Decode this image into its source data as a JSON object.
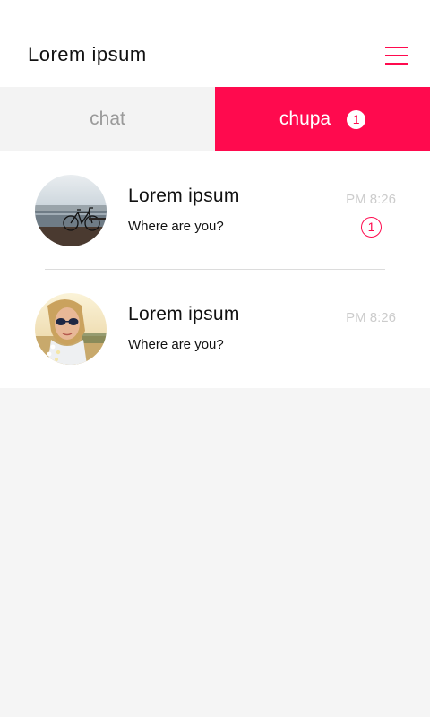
{
  "header": {
    "title": "Lorem ipsum",
    "menu_icon": "hamburger-menu-icon"
  },
  "tabs": [
    {
      "label": "chat",
      "active": false
    },
    {
      "label": "chupa",
      "active": true,
      "badge": "1"
    }
  ],
  "conversations": [
    {
      "name": "Lorem ipsum",
      "message": "Where are you?",
      "time": "PM 8:26",
      "unread": "1",
      "avatar": "bicycle-photo"
    },
    {
      "name": "Lorem ipsum",
      "message": "Where are you?",
      "time": "PM 8:26",
      "avatar": "woman-sunglasses-photo"
    }
  ],
  "colors": {
    "accent": "#ff0a4e",
    "background": "#f5f5f5",
    "muted": "#9a9a9a"
  }
}
